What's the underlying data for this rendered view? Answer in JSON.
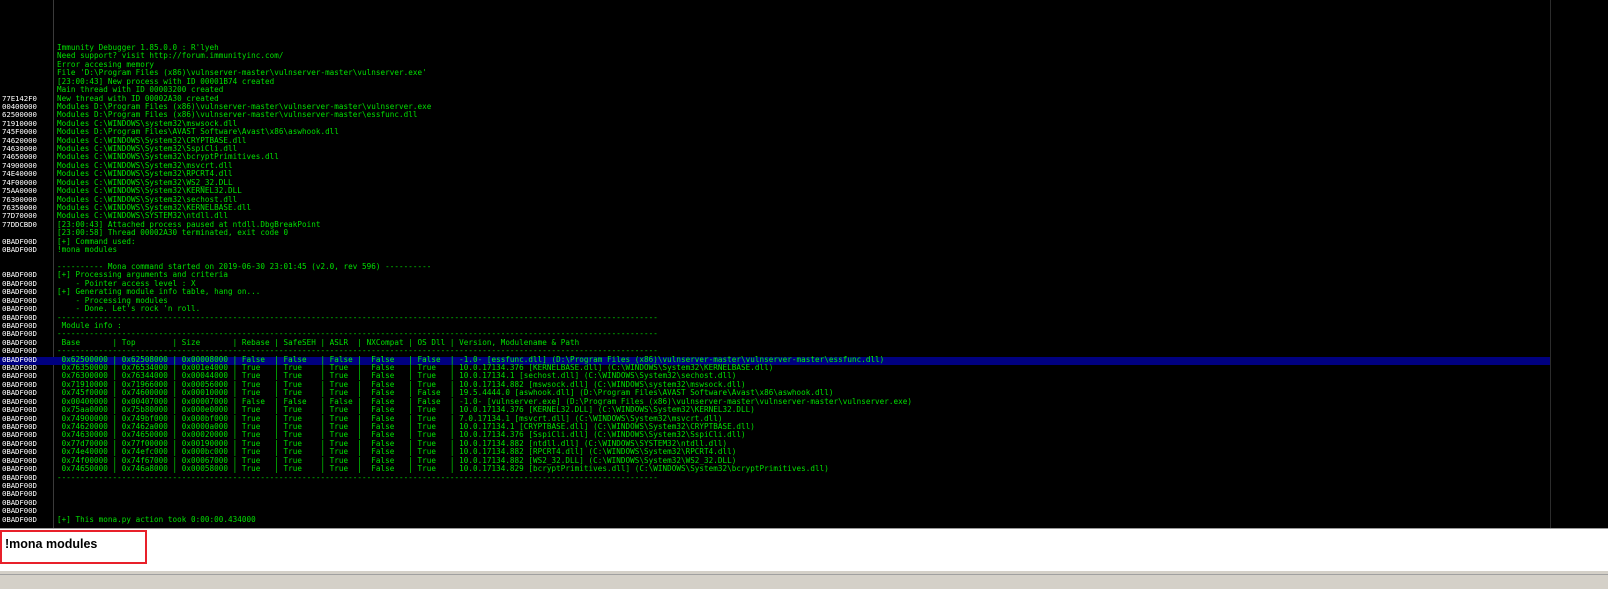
{
  "log": {
    "lines": [
      {
        "addr": "",
        "text": "Immunity Debugger 1.85.0.0 : R'lyeh"
      },
      {
        "addr": "",
        "text": "Need support? visit http://forum.immunityinc.com/"
      },
      {
        "addr": "",
        "text": "Error accesing memory"
      },
      {
        "addr": "",
        "text": "File 'D:\\Program Files (x86)\\vulnserver-master\\vulnserver-master\\vulnserver.exe'"
      },
      {
        "addr": "",
        "text": "[23:00:43] New process with ID 00001B74 created"
      },
      {
        "addr": "",
        "text": "Main thread with ID 00003200 created"
      },
      {
        "addr": "77E142F0",
        "text": "New thread with ID 00002A30 created"
      },
      {
        "addr": "00400000",
        "text": "Modules D:\\Program Files (x86)\\vulnserver-master\\vulnserver-master\\vulnserver.exe"
      },
      {
        "addr": "62500000",
        "text": "Modules D:\\Program Files (x86)\\vulnserver-master\\vulnserver-master\\essfunc.dll"
      },
      {
        "addr": "71910000",
        "text": "Modules C:\\WINDOWS\\system32\\mswsock.dll"
      },
      {
        "addr": "745F0000",
        "text": "Modules D:\\Program Files\\AVAST Software\\Avast\\x86\\aswhook.dll"
      },
      {
        "addr": "74620000",
        "text": "Modules C:\\WINDOWS\\System32\\CRYPTBASE.dll"
      },
      {
        "addr": "74630000",
        "text": "Modules C:\\WINDOWS\\System32\\SspiCli.dll"
      },
      {
        "addr": "74650000",
        "text": "Modules C:\\WINDOWS\\System32\\bcryptPrimitives.dll"
      },
      {
        "addr": "74900000",
        "text": "Modules C:\\WINDOWS\\System32\\msvcrt.dll"
      },
      {
        "addr": "74E40000",
        "text": "Modules C:\\WINDOWS\\System32\\RPCRT4.dll"
      },
      {
        "addr": "74F00000",
        "text": "Modules C:\\WINDOWS\\System32\\WS2_32.DLL"
      },
      {
        "addr": "75AA0000",
        "text": "Modules C:\\WINDOWS\\System32\\KERNEL32.DLL"
      },
      {
        "addr": "76300000",
        "text": "Modules C:\\WINDOWS\\System32\\sechost.dll"
      },
      {
        "addr": "76350000",
        "text": "Modules C:\\WINDOWS\\System32\\KERNELBASE.dll"
      },
      {
        "addr": "77D70000",
        "text": "Modules C:\\WINDOWS\\SYSTEM32\\ntdll.dll"
      },
      {
        "addr": "77DDCBD0",
        "text": "[23:00:43] Attached process paused at ntdll.DbgBreakPoint"
      },
      {
        "addr": "",
        "text": "[23:00:58] Thread 00002A30 terminated, exit code 0"
      },
      {
        "addr": "0BADF00D",
        "text": "[+] Command used:"
      },
      {
        "addr": "0BADF00D",
        "text": "!mona modules"
      },
      {
        "addr": "",
        "text": ""
      },
      {
        "addr": "",
        "text": "---------- Mona command started on 2019-06-30 23:01:45 (v2.0, rev 596) ----------"
      },
      {
        "addr": "0BADF00D",
        "text": "[+] Processing arguments and criteria"
      },
      {
        "addr": "0BADF00D",
        "text": "    - Pointer access level : X"
      },
      {
        "addr": "0BADF00D",
        "text": "[+] Generating module info table, hang on..."
      },
      {
        "addr": "0BADF00D",
        "text": "    - Processing modules"
      },
      {
        "addr": "0BADF00D",
        "text": "    - Done. Let's rock 'n roll."
      },
      {
        "addr": "0BADF00D",
        "text": "----------------------------------------------------------------------------------------------------------------------------------"
      },
      {
        "addr": "0BADF00D",
        "text": " Module info :"
      },
      {
        "addr": "0BADF00D",
        "text": "----------------------------------------------------------------------------------------------------------------------------------"
      },
      {
        "addr": "0BADF00D",
        "text": " Base       | Top        | Size       | Rebase | SafeSEH | ASLR  | NXCompat | OS Dll | Version, Modulename & Path"
      },
      {
        "addr": "0BADF00D",
        "text": "----------------------------------------------------------------------------------------------------------------------------------"
      },
      {
        "addr": "0BADF00D",
        "text": " 0x62500000 | 0x62508000 | 0x00008000 | False  | False   | False |  False   | False  | -1.0- [essfunc.dll] (D:\\Program Files (x86)\\vulnserver-master\\vulnserver-master\\essfunc.dll)",
        "selected": true
      },
      {
        "addr": "0BADF00D",
        "text": " 0x76350000 | 0x76534000 | 0x001e4000 | True   | True    | True  |  False   | True   | 10.0.17134.376 [KERNELBASE.dll] (C:\\WINDOWS\\System32\\KERNELBASE.dll)"
      },
      {
        "addr": "0BADF00D",
        "text": " 0x76300000 | 0x76344000 | 0x00044000 | True   | True    | True  |  False   | True   | 10.0.17134.1 [sechost.dll] (C:\\WINDOWS\\System32\\sechost.dll)"
      },
      {
        "addr": "0BADF00D",
        "text": " 0x71910000 | 0x71966000 | 0x00056000 | True   | True    | True  |  False   | True   | 10.0.17134.882 [mswsock.dll] (C:\\WINDOWS\\system32\\mswsock.dll)"
      },
      {
        "addr": "0BADF00D",
        "text": " 0x745f0000 | 0x74600000 | 0x00010000 | True   | True    | True  |  False   | False  | 19.5.4444.0 [aswhook.dll] (D:\\Program Files\\AVAST Software\\Avast\\x86\\aswhook.dll)"
      },
      {
        "addr": "0BADF00D",
        "text": " 0x00400000 | 0x00407000 | 0x00007000 | False  | False   | False |  False   | False  | -1.0- [vulnserver.exe] (D:\\Program Files (x86)\\vulnserver-master\\vulnserver-master\\vulnserver.exe)"
      },
      {
        "addr": "0BADF00D",
        "text": " 0x75aa0000 | 0x75b80000 | 0x000e0000 | True   | True    | True  |  False   | True   | 10.0.17134.376 [KERNEL32.DLL] (C:\\WINDOWS\\System32\\KERNEL32.DLL)"
      },
      {
        "addr": "0BADF00D",
        "text": " 0x74900000 | 0x749bf000 | 0x000bf000 | True   | True    | True  |  False   | True   | 7.0.17134.1 [msvcrt.dll] (C:\\WINDOWS\\System32\\msvcrt.dll)"
      },
      {
        "addr": "0BADF00D",
        "text": " 0x74620000 | 0x7462a000 | 0x0000a000 | True   | True    | True  |  False   | True   | 10.0.17134.1 [CRYPTBASE.dll] (C:\\WINDOWS\\System32\\CRYPTBASE.dll)"
      },
      {
        "addr": "0BADF00D",
        "text": " 0x74630000 | 0x74650000 | 0x00020000 | True   | True    | True  |  False   | True   | 10.0.17134.376 [SspiCli.dll] (C:\\WINDOWS\\System32\\SspiCli.dll)"
      },
      {
        "addr": "0BADF00D",
        "text": " 0x77d70000 | 0x77f00000 | 0x00190000 | True   | True    | True  |  False   | True   | 10.0.17134.882 [ntdll.dll] (C:\\WINDOWS\\SYSTEM32\\ntdll.dll)"
      },
      {
        "addr": "0BADF00D",
        "text": " 0x74e40000 | 0x74efc000 | 0x000bc000 | True   | True    | True  |  False   | True   | 10.0.17134.882 [RPCRT4.dll] (C:\\WINDOWS\\System32\\RPCRT4.dll)"
      },
      {
        "addr": "0BADF00D",
        "text": " 0x74f00000 | 0x74f67000 | 0x00067000 | True   | True    | True  |  False   | True   | 10.0.17134.882 [WS2_32.DLL] (C:\\WINDOWS\\System32\\WS2_32.DLL)"
      },
      {
        "addr": "0BADF00D",
        "text": " 0x74650000 | 0x746a8000 | 0x00058000 | True   | True    | True  |  False   | True   | 10.0.17134.829 [bcryptPrimitives.dll] (C:\\WINDOWS\\System32\\bcryptPrimitives.dll)"
      },
      {
        "addr": "0BADF00D",
        "text": "----------------------------------------------------------------------------------------------------------------------------------"
      },
      {
        "addr": "0BADF00D",
        "text": ""
      },
      {
        "addr": "0BADF00D",
        "text": ""
      },
      {
        "addr": "0BADF00D",
        "text": ""
      },
      {
        "addr": "0BADF00D",
        "text": ""
      },
      {
        "addr": "0BADF00D",
        "text": "[+] This mona.py action took 0:00:00.434000"
      }
    ]
  },
  "command_bar": {
    "value": "!mona modules"
  },
  "colors": {
    "log_text": "#00e000",
    "address_text": "#ffffff",
    "selection_bg": "#000080",
    "highlight_box": "#e8202a"
  }
}
